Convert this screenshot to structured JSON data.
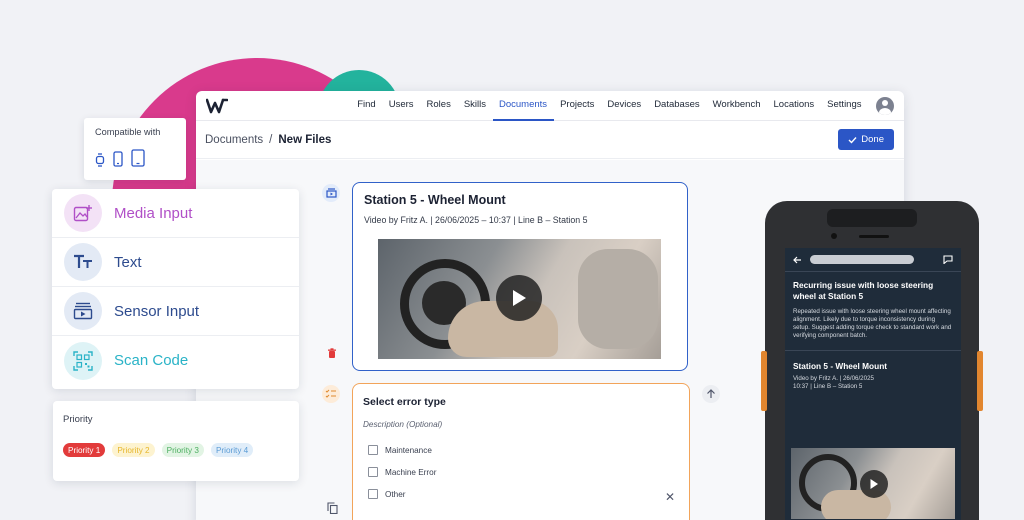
{
  "colors": {
    "accent": "#2b56c6",
    "brand_pink": "#d93a8c",
    "brand_teal": "#23b39d",
    "video_card_border": "#3161c9",
    "error_card_border": "#f2a45a"
  },
  "nav": {
    "logo": "logo-icon",
    "items": [
      "Find",
      "Users",
      "Roles",
      "Skills",
      "Documents",
      "Projects",
      "Devices",
      "Databases",
      "Workbench",
      "Locations",
      "Settings"
    ],
    "active": "Documents"
  },
  "breadcrumb": {
    "parent": "Documents",
    "separator": "/",
    "current": "New Files"
  },
  "done_button": {
    "label": "Done"
  },
  "video_card": {
    "title": "Station 5 - Wheel Mount",
    "subtitle": "Video by Fritz A. | 26/06/2025 – 10:37 | Line B – Station 5"
  },
  "error_card": {
    "title": "Select error type",
    "description": "Description (Optional)",
    "options": [
      "Maintenance",
      "Machine Error",
      "Other"
    ]
  },
  "compatible": {
    "label": "Compatible with",
    "devices": [
      "watch-icon",
      "phone-icon",
      "tablet-icon"
    ]
  },
  "input_types": [
    {
      "label": "Media Input",
      "icon": "image-add-icon",
      "color": "#b04fc7"
    },
    {
      "label": "Text",
      "icon": "text-icon",
      "color": "#2d4b8e"
    },
    {
      "label": "Sensor Input",
      "icon": "sensor-icon",
      "color": "#2d4b8e"
    },
    {
      "label": "Scan Code",
      "icon": "qr-code-icon",
      "color": "#2ab3c7"
    }
  ],
  "priority": {
    "label": "Priority",
    "tags": [
      {
        "label": "Priority 1",
        "bg": "#e23b3b",
        "fg": "#ffffff"
      },
      {
        "label": "Priority 2",
        "bg": "#fdf3d0",
        "fg": "#e6b62b"
      },
      {
        "label": "Priority 3",
        "bg": "#e2f4e4",
        "fg": "#4caf60"
      },
      {
        "label": "Priority 4",
        "bg": "#e0edf9",
        "fg": "#5a9bd5"
      }
    ]
  },
  "phone": {
    "issue_title": "Recurring issue with loose steering wheel at Station 5",
    "issue_text": "Repeated issue with loose steering wheel mount affecting alignment. Likely due to torque inconsistency during setup. Suggest adding torque check to standard work and verifying component batch.",
    "video_title": "Station 5 - Wheel Mount",
    "video_line1": "Video by Fritz A. | 26/06/2025",
    "video_line2": "10:37 | Line B – Station 5"
  }
}
